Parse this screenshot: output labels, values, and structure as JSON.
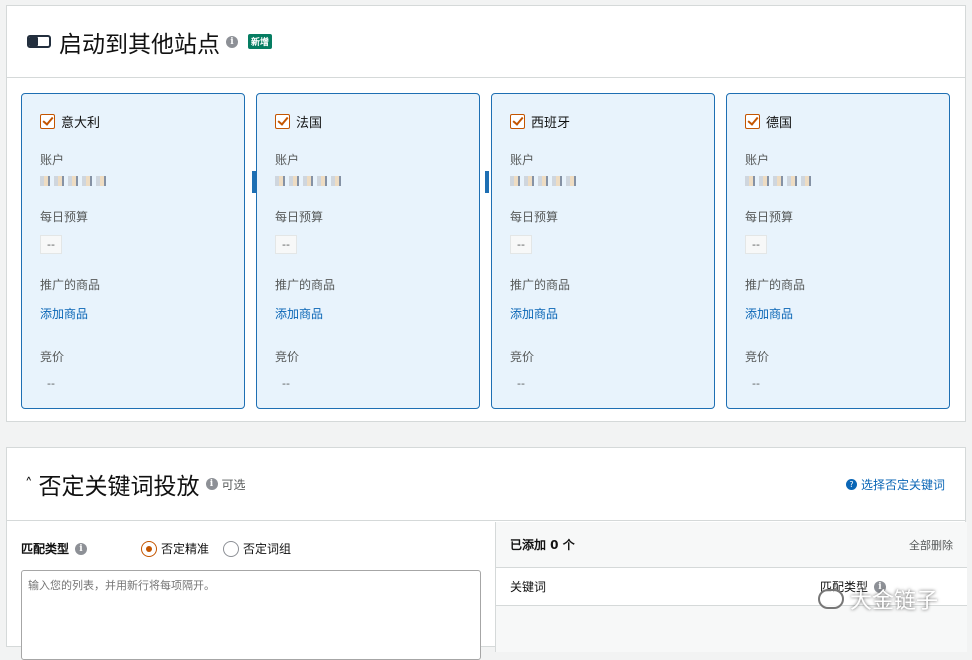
{
  "launch": {
    "title": "启动到其他站点",
    "badge": "新增",
    "field_account": "账户",
    "field_budget": "每日预算",
    "field_products": "推广的商品",
    "add_product": "添加商品",
    "field_bid": "竞价",
    "empty_value": "--",
    "sites": [
      {
        "name": "意大利",
        "checked": true
      },
      {
        "name": "法国",
        "checked": true
      },
      {
        "name": "西班牙",
        "checked": true
      },
      {
        "name": "德国",
        "checked": true
      }
    ]
  },
  "negative": {
    "title": "否定关键词投放",
    "optional": "可选",
    "help_link": "选择否定关键词",
    "match_type_label": "匹配类型",
    "match_options": [
      "否定精准",
      "否定词组"
    ],
    "selected_match": "否定精准",
    "textarea_placeholder": "输入您的列表，并用新行将每项隔开。",
    "added_label": "已添加 0 个",
    "delete_all": "全部删除",
    "col_keyword": "关键词",
    "col_match": "匹配类型"
  },
  "watermark": "大金链子",
  "colors": {
    "accent": "#1e6fb3",
    "check": "#c45500",
    "badge": "#067d62"
  }
}
